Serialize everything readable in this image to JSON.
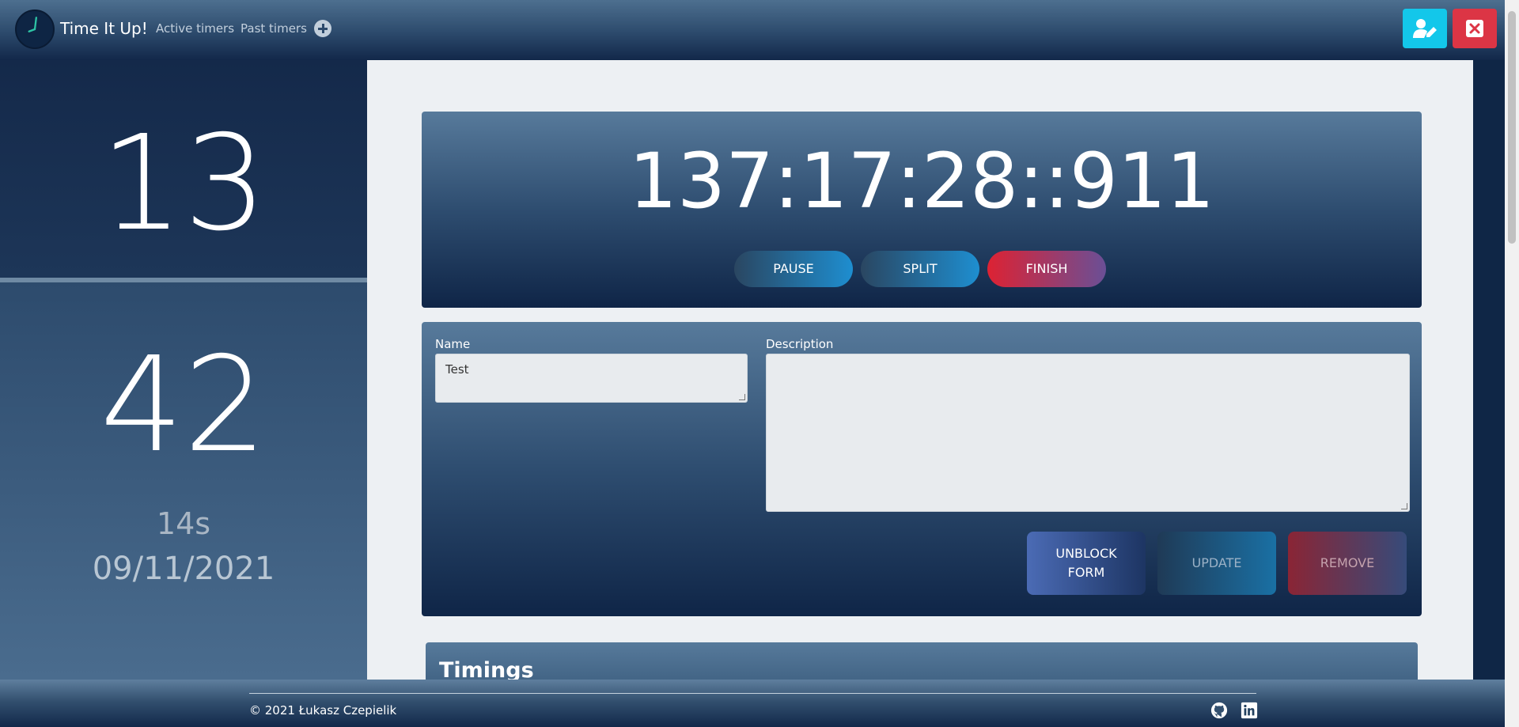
{
  "app": {
    "title": "Time It Up!"
  },
  "nav": {
    "items": [
      {
        "label": "Active timers"
      },
      {
        "label": "Past timers"
      }
    ],
    "add_icon": "plus-circle-icon",
    "actions": {
      "edit_icon": "user-edit-icon",
      "close_icon": "close-icon"
    }
  },
  "sidebar": {
    "value_top": "13",
    "value_bottom": "42",
    "seconds": "14s",
    "date": "09/11/2021"
  },
  "timer": {
    "display": "137:17:28::911",
    "buttons": {
      "pause": "PAUSE",
      "split": "SPLIT",
      "finish": "FINISH"
    }
  },
  "form": {
    "name_label": "Name",
    "name_value": "Test",
    "description_label": "Description",
    "description_value": "",
    "buttons": {
      "unblock_line1": "UNBLOCK",
      "unblock_line2": "FORM",
      "update": "UPDATE",
      "remove": "REMOVE"
    }
  },
  "timings": {
    "title": "Timings"
  },
  "footer": {
    "copyright": "© 2021 Łukasz Czepielik",
    "icons": [
      "github-icon",
      "linkedin-icon"
    ]
  },
  "colors": {
    "accent_cyan": "#13c7ea",
    "danger": "#dc3545",
    "navy": "#0e2544"
  }
}
